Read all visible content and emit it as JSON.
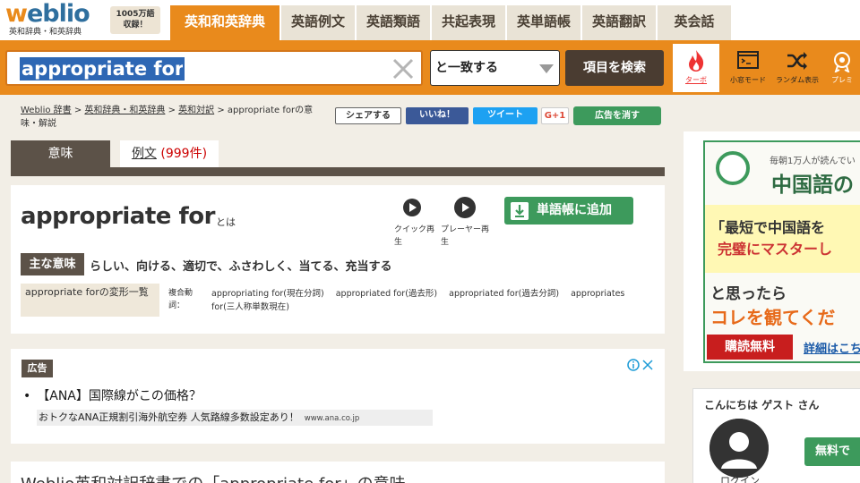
{
  "header": {
    "logo_text": "weblio",
    "logo_subtitle": "英和辞典・和英辞典",
    "count_badge_line1": "1005万語",
    "count_badge_line2": "収録！",
    "tabs": [
      {
        "label": "英和和英辞典",
        "active": true
      },
      {
        "label": "英語例文",
        "active": false
      },
      {
        "label": "英語類語",
        "active": false
      },
      {
        "label": "共起表現",
        "active": false
      },
      {
        "label": "英単語帳",
        "active": false
      },
      {
        "label": "英語翻訳",
        "active": false
      },
      {
        "label": "英会話",
        "active": false
      }
    ]
  },
  "search": {
    "query": "appropriate for",
    "match_mode": "と一致する",
    "search_button": "項目を検索",
    "tools": [
      {
        "label": "ターボ",
        "icon": "flame-icon"
      },
      {
        "label": "小窓モード",
        "icon": "terminal-window-icon"
      },
      {
        "label": "ランダム表示",
        "icon": "shuffle-icon"
      },
      {
        "label": "プレミ",
        "icon": "premium-badge-icon"
      }
    ]
  },
  "breadcrumb": {
    "items": [
      "Weblio 辞書",
      "英和辞典・和英辞典",
      "英和対訳"
    ],
    "current": "appropriate forの意味・解説",
    "separator": " > "
  },
  "share": {
    "share_label": "シェアする",
    "like_label": "いいね！",
    "tweet_label": "ツイート",
    "gplus_label": "G+1",
    "hide_ads_label": "広告を消す"
  },
  "meaning_tabs": {
    "meaning": "意味",
    "examples": "例文",
    "examples_count": "(999件)"
  },
  "entry": {
    "word": "appropriate for",
    "toha": "とは",
    "quick_play": "クイック再生",
    "player_play": "プレーヤー再生",
    "add_wordbook": "単語帳に追加",
    "main_meaning_label": "主な意味",
    "main_meaning": "らしい、向ける、適切で、ふさわしく、当てる、充当する",
    "inflection_label": "appropriate forの変形一覧",
    "inflection_type": "複合動詞：",
    "inflections": [
      "appropriating for(現在分詞)",
      "appropriated for(過去形)",
      "appropriated for(過去分詞)",
      "appropriates for(三人称単数現在)"
    ]
  },
  "ad": {
    "label": "広告",
    "title": "•　【ANA】国際線がこの価格？",
    "description": "おトクなANA正規割引海外航空券 人気路線多数設定あり！",
    "url": "www.ana.co.jp"
  },
  "bottom": {
    "title": "Weblio英和対訳辞書での「appropriate for」の意味"
  },
  "side_ad": {
    "sub": "毎朝1万人が読んでい",
    "head": "中国語の",
    "line1": "「最短で中国語を",
    "line2": "完璧にマスターし",
    "line3": "と思ったら",
    "line4": "コレを観てくだ",
    "buy": "購読無料",
    "detail": "詳細はこち"
  },
  "user": {
    "greeting": "こんにちは ゲスト さん",
    "login": "ログイン",
    "register": "無料で"
  },
  "colors": {
    "brand_orange": "#e98a1c",
    "brand_blue": "#2f6f9e",
    "dark_brown": "#5c5248",
    "green": "#3d9a5c"
  }
}
